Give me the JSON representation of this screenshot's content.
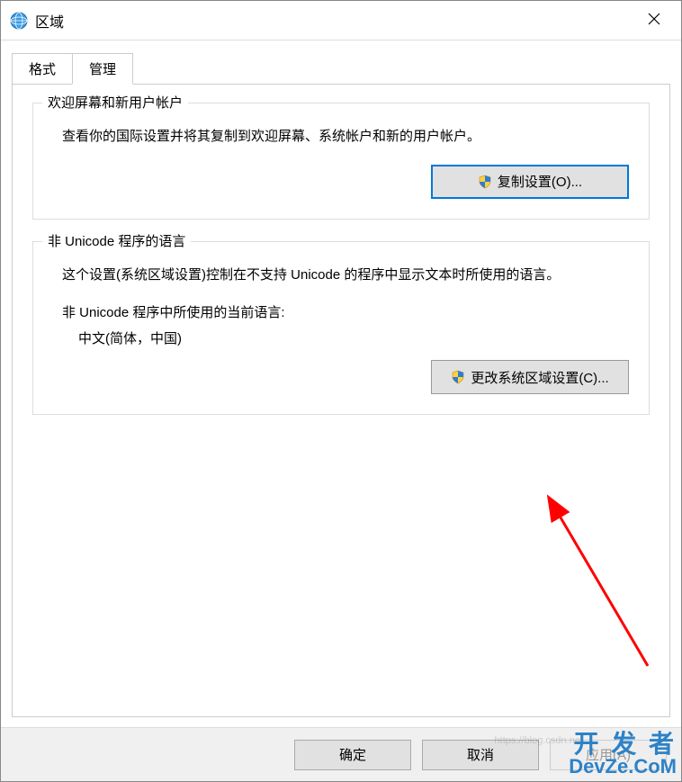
{
  "window": {
    "title": "区域"
  },
  "tabs": {
    "format": "格式",
    "admin": "管理"
  },
  "group1": {
    "legend": "欢迎屏幕和新用户帐户",
    "desc": "查看你的国际设置并将其复制到欢迎屏幕、系统帐户和新的用户帐户。",
    "button": "复制设置(O)..."
  },
  "group2": {
    "legend": "非 Unicode 程序的语言",
    "desc": "这个设置(系统区域设置)控制在不支持 Unicode 的程序中显示文本时所使用的语言。",
    "sublabel": "非 Unicode 程序中所使用的当前语言:",
    "subvalue": "中文(简体，中国)",
    "button": "更改系统区域设置(C)..."
  },
  "footer": {
    "ok": "确定",
    "cancel": "取消",
    "apply": "应用(A)"
  },
  "watermark": {
    "l1": "开 发 者",
    "l2": "DevZe.CoM",
    "url": "https://blog.csdn.net"
  }
}
